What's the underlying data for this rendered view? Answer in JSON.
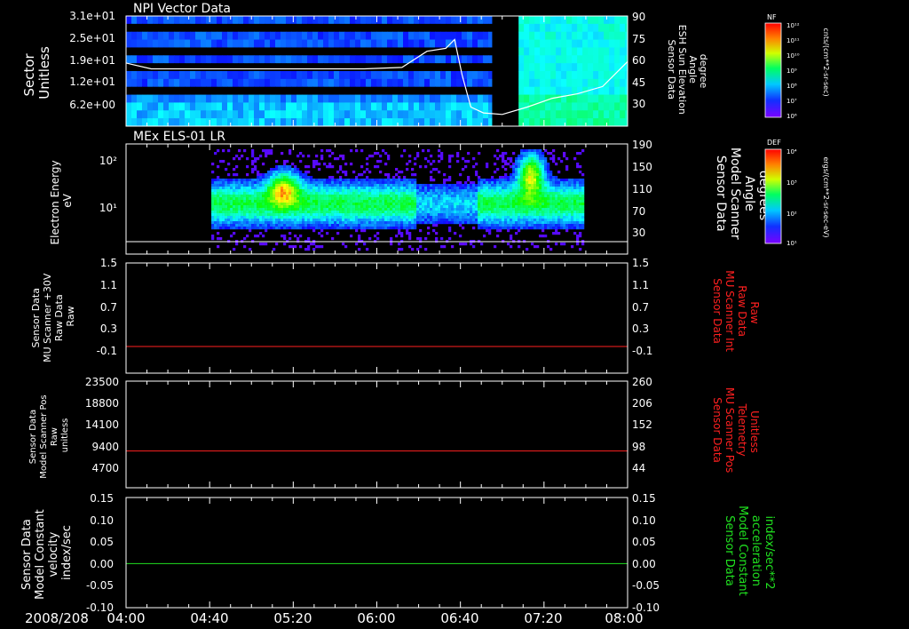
{
  "colors": {
    "background": "#000000",
    "axis": "#ffffff",
    "red": "#ff2020",
    "green": "#20e020"
  },
  "timeline": {
    "date_label": "2008/208",
    "tick_labels": [
      "04:00",
      "04:40",
      "05:20",
      "06:00",
      "06:40",
      "07:20",
      "08:00"
    ]
  },
  "chart_data": [
    {
      "type": "heatmap",
      "title": "NPI Vector Data",
      "ylabel": [
        "Sector",
        "Unitless"
      ],
      "y_ticks": [
        "3.1e+01",
        "2.5e+01",
        "1.9e+01",
        "1.2e+01",
        "6.2e+00"
      ],
      "ylim": [
        0,
        31
      ],
      "right_ylabel": [
        "Sensor Data",
        "ESH Sun Elevation",
        "Angle",
        "degree"
      ],
      "right_ticks": [
        "90",
        "75",
        "60",
        "45",
        "30"
      ],
      "right_ylim": [
        15,
        90
      ],
      "overlay_line": {
        "color": "#ffffff",
        "x_hours": [
          4.0,
          4.2,
          4.8,
          5.5,
          5.9,
          6.2,
          6.4,
          6.55,
          6.62,
          6.68,
          6.75,
          6.85,
          7.0,
          7.2,
          7.4,
          7.6,
          7.8,
          8.0
        ],
        "y_deg": [
          58,
          54,
          54,
          54,
          54,
          55,
          66,
          68,
          74,
          50,
          28,
          24,
          23,
          28,
          34,
          37,
          42,
          59
        ]
      },
      "colorbar": {
        "label": "NF",
        "unit": "cnts/(cm**2-sr-sec)",
        "ticks": [
          "10¹²",
          "10¹¹",
          "10¹⁰",
          "10⁹",
          "10⁸",
          "10⁷",
          "10⁶"
        ]
      }
    },
    {
      "type": "heatmap",
      "title": "MEx ELS-01 LR",
      "ylabel": [
        "Electron Energy",
        "eV"
      ],
      "y_ticks": [
        "10²",
        "10¹"
      ],
      "yscale": "log",
      "ylim": [
        1,
        200
      ],
      "right_ylabel": [
        "Sensor Data",
        "Model Scanner",
        "Angle",
        "degrees"
      ],
      "right_ticks": [
        "190",
        "150",
        "110",
        "70",
        "30"
      ],
      "right_ylim": [
        10,
        190
      ],
      "colorbar": {
        "label": "DEF",
        "unit": "ergs/(cm**2-sr-sec-eV)",
        "ticks": [
          "10⁴",
          "10³",
          "10²",
          "10¹"
        ]
      }
    },
    {
      "type": "line",
      "ylabel": [
        "Sensor Data",
        "MU Scanner +30V",
        "Raw Data",
        "Raw"
      ],
      "y_ticks": [
        "1.5",
        "1.1",
        "0.7",
        "0.3",
        "-0.1"
      ],
      "ylim": [
        -0.4,
        1.5
      ],
      "right_ylabel": [
        "Sensor Data",
        "MU Scanner Int",
        "Raw Data",
        "Raw"
      ],
      "right_ticks": [
        "1.5",
        "1.1",
        "0.7",
        "0.3",
        "-0.1"
      ],
      "series": [
        {
          "name": "MU Scanner Int",
          "color": "#ff2020",
          "x": [
            4.0,
            8.0
          ],
          "y": [
            0.06,
            0.06
          ]
        }
      ]
    },
    {
      "type": "line",
      "ylabel": [
        "Sensor Data",
        "Model Scanner Pos",
        "Raw",
        "unitless"
      ],
      "y_ticks": [
        "23500",
        "18800",
        "14100",
        "9400",
        "4700"
      ],
      "ylim": [
        0,
        23500
      ],
      "right_ylabel": [
        "Sensor Data",
        "MU Scanner Pos",
        "Telemetry",
        "Unitless"
      ],
      "right_ticks": [
        "260",
        "206",
        "152",
        "98",
        "44"
      ],
      "series": [
        {
          "name": "MU Scanner Pos",
          "color": "#ff2020",
          "x": [
            4.0,
            8.0
          ],
          "y": [
            8100,
            8100
          ]
        }
      ]
    },
    {
      "type": "line",
      "ylabel": [
        "Sensor Data",
        "Model Constant",
        "velocity",
        "index/sec"
      ],
      "y_ticks": [
        "0.15",
        "0.10",
        "0.05",
        "0.00",
        "-0.05",
        "-0.10"
      ],
      "ylim": [
        -0.1,
        0.15
      ],
      "right_ylabel": [
        "Sensor Data",
        "Model Constant",
        "acceleration",
        "index/sec**2"
      ],
      "right_ticks": [
        "0.15",
        "0.10",
        "0.05",
        "0.00",
        "-0.05",
        "-0.10"
      ],
      "series": [
        {
          "name": "Model Constant acceleration",
          "color": "#20e020",
          "x": [
            4.0,
            8.0
          ],
          "y": [
            0.0,
            0.0
          ]
        }
      ]
    }
  ]
}
